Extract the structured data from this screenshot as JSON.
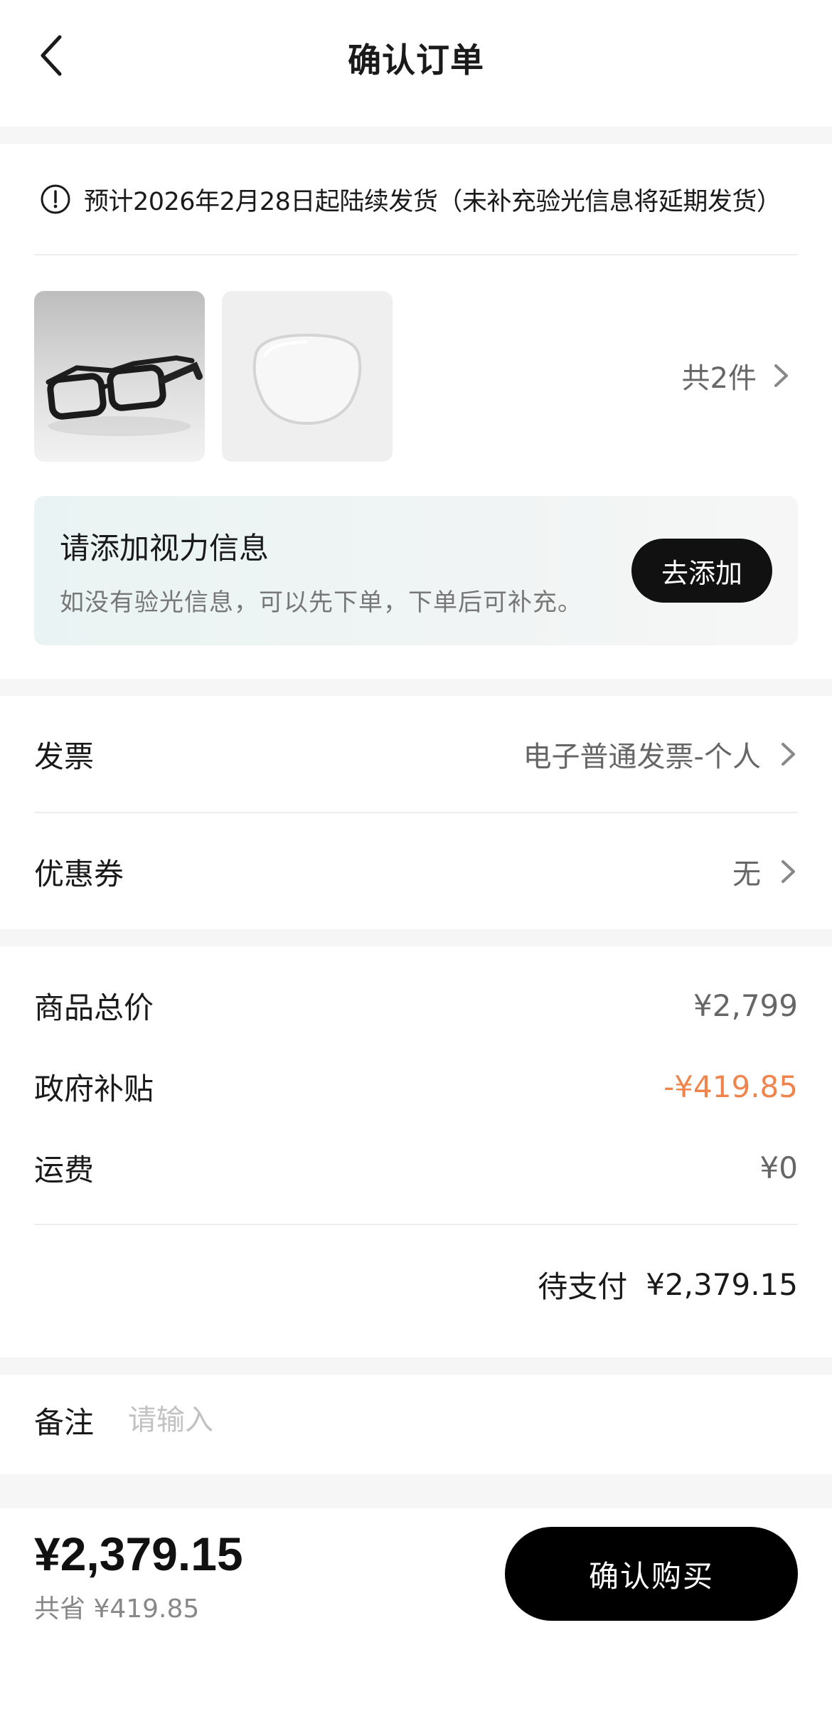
{
  "header": {
    "title": "确认订单"
  },
  "shipping": {
    "notice": "预计2026年2月28日起陆续发货（未补充验光信息将延期发货）"
  },
  "items": {
    "count_label": "共2件",
    "thumbnails": [
      "smart-glasses",
      "optical-lens"
    ]
  },
  "vision": {
    "title": "请添加视力信息",
    "subtitle": "如没有验光信息，可以先下单，下单后可补充。",
    "add_button": "去添加"
  },
  "invoice": {
    "label": "发票",
    "value": "电子普通发票-个人"
  },
  "coupon": {
    "label": "优惠券",
    "value": "无"
  },
  "pricing": {
    "subtotal_label": "商品总价",
    "subtotal_value": "¥2,799",
    "subsidy_label": "政府补贴",
    "subsidy_value": "-¥419.85",
    "shipping_label": "运费",
    "shipping_value": "¥0",
    "due_label": "待支付",
    "due_value": "¥2,379.15"
  },
  "remark": {
    "label": "备注",
    "placeholder": "请输入",
    "value": ""
  },
  "footer": {
    "total": "¥2,379.15",
    "saved": "共省 ¥419.85",
    "confirm_button": "确认购买"
  },
  "colors": {
    "accent_discount": "#f0844d",
    "button_dark": "#111111",
    "section_gap": "#f6f6f6"
  }
}
